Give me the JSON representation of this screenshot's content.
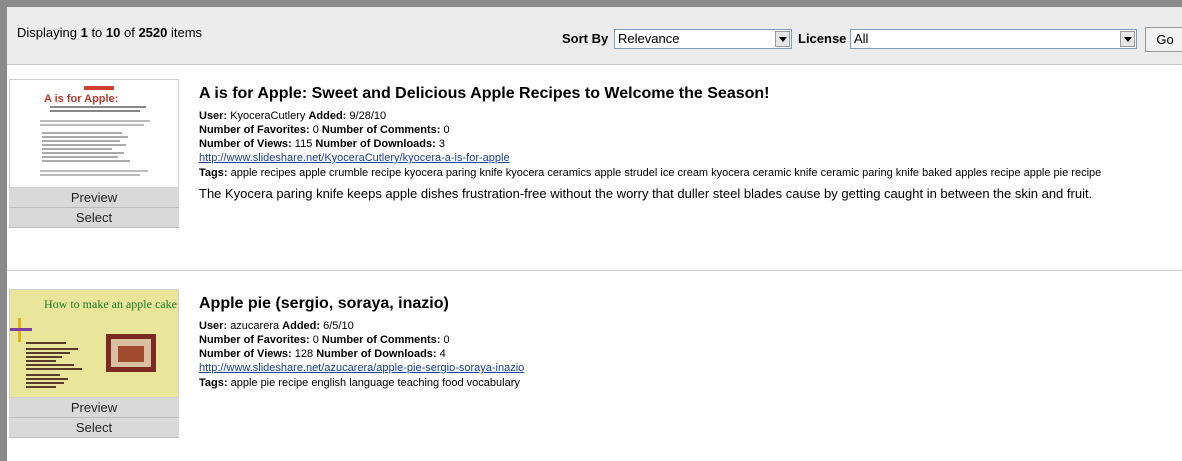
{
  "toolbar": {
    "display_prefix": "Displaying ",
    "display_from": "1",
    "display_to_word": " to ",
    "display_to": "10",
    "display_of_word": " of ",
    "display_total": "2520",
    "display_suffix": " items",
    "sort_label": "Sort By",
    "sort_value": "Relevance",
    "license_label": "License",
    "license_value": "All",
    "go_label": "Go"
  },
  "results": [
    {
      "title": "A is for Apple: Sweet and Delicious Apple Recipes to Welcome the Season!",
      "user_label": "User:",
      "user": "KyoceraCutlery",
      "added_label": "Added:",
      "added": "9/28/10",
      "favorites_label": "Number of Favorites:",
      "favorites": "0",
      "comments_label": "Number of Comments:",
      "comments": "0",
      "views_label": "Number of Views:",
      "views": "115",
      "downloads_label": "Number of Downloads:",
      "downloads": "3",
      "url": "http://www.slideshare.net/KyoceraCutlery/kyocera-a-is-for-apple",
      "tags_label": "Tags:",
      "tags": "apple recipes apple crumble recipe kyocera paring knife kyocera ceramics apple strudel ice cream kyocera ceramic knife ceramic paring knife baked apples recipe apple pie recipe",
      "description": "The Kyocera paring knife keeps apple dishes frustration-free without the worry that duller steel blades cause by getting caught in between the skin and fruit.",
      "thumb_heading": "A is for Apple:",
      "preview_label": "Preview",
      "select_label": "Select"
    },
    {
      "title": "Apple pie (sergio, soraya, inazio)",
      "user_label": "User:",
      "user": "azucarera",
      "added_label": "Added:",
      "added": "6/5/10",
      "favorites_label": "Number of Favorites:",
      "favorites": "0",
      "comments_label": "Number of Comments:",
      "comments": "0",
      "views_label": "Number of Views:",
      "views": "128",
      "downloads_label": "Number of Downloads:",
      "downloads": "4",
      "url": "http://www.slideshare.net/azucarera/apple-pie-sergio-soraya-inazio",
      "tags_label": "Tags:",
      "tags": "apple pie recipe english language teaching food vocabulary",
      "thumb_heading": "How to make an apple cake",
      "preview_label": "Preview",
      "select_label": "Select"
    }
  ]
}
